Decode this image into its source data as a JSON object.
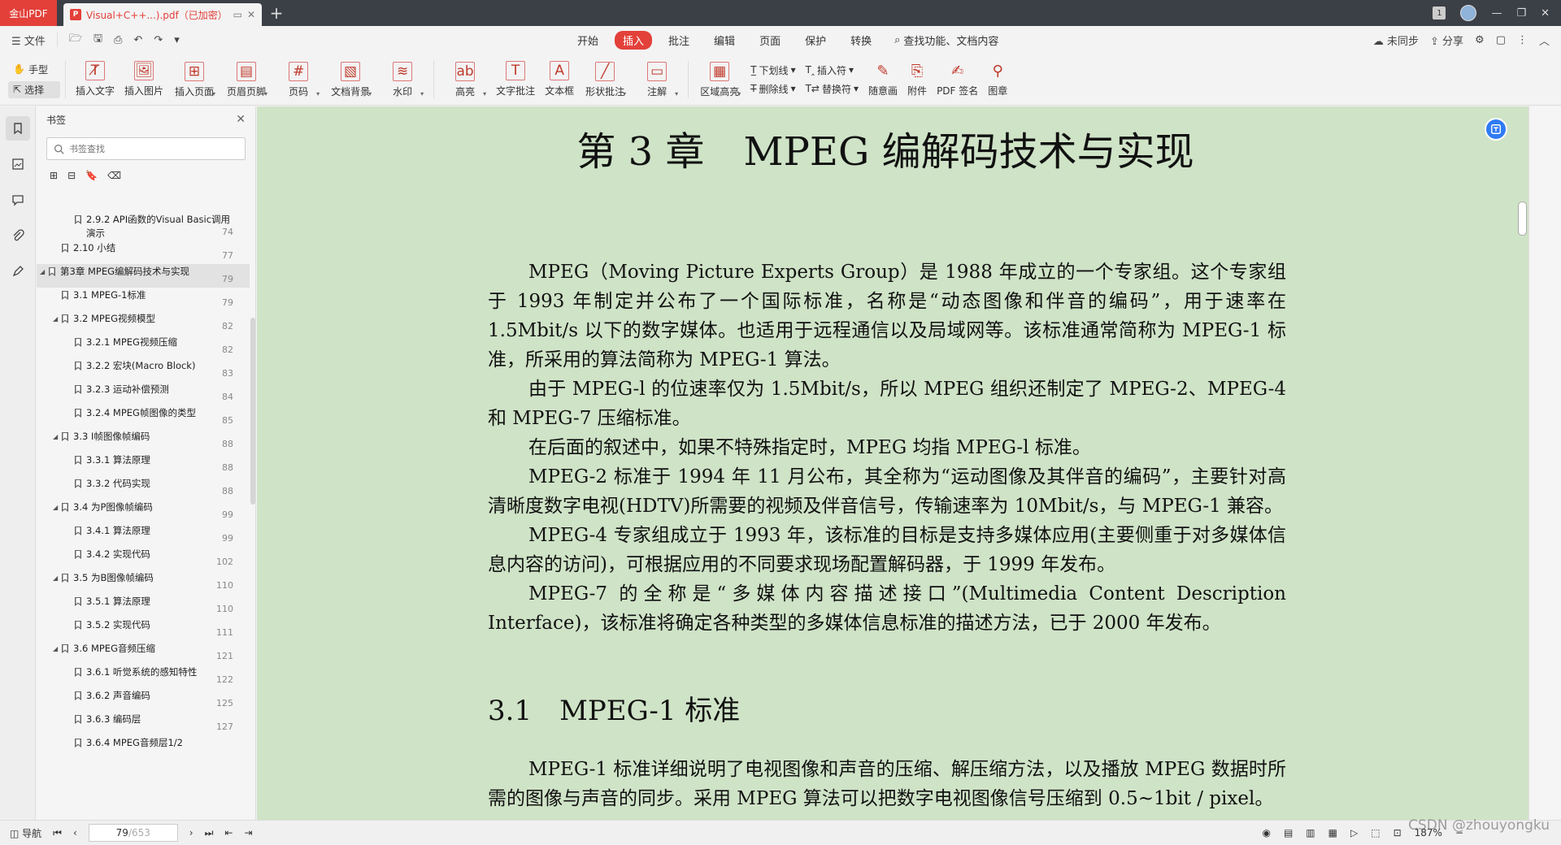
{
  "titlebar": {
    "app_name": "金山PDF",
    "tab_title": "Visual+C++...).pdf（已加密）",
    "tab_badge": "1"
  },
  "menubar": {
    "file_label": "文件",
    "tabs": [
      "开始",
      "插入",
      "批注",
      "编辑",
      "页面",
      "保护",
      "转换"
    ],
    "active_tab": "插入",
    "search_label": "查找功能、文档内容",
    "sync_label": "未同步",
    "share_label": "分享"
  },
  "ribbon": {
    "hand_label": "手型",
    "select_label": "选择",
    "buttons": [
      "插入文字",
      "插入图片",
      "插入页面",
      "页眉页脚",
      "页码",
      "文档背景",
      "水印",
      "高亮",
      "文字批注",
      "文本框",
      "形状批注",
      "注解",
      "区域高亮"
    ],
    "pair1": [
      "下划线",
      "删除线"
    ],
    "pair2": [
      "插入符",
      "替换符"
    ],
    "tail_buttons": [
      "随意画",
      "附件",
      "PDF 签名",
      "图章"
    ]
  },
  "panel": {
    "title": "书签",
    "search_placeholder": "书签查找",
    "items": [
      {
        "label": "2.9.2 API函数的Visual Basic调用演示",
        "page": "74",
        "level": 2,
        "toggle": ""
      },
      {
        "label": "2.10 小结",
        "page": "77",
        "level": 1,
        "toggle": ""
      },
      {
        "label": "第3章 MPEG编解码技术与实现",
        "page": "79",
        "level": 0,
        "toggle": "◢"
      },
      {
        "label": "3.1 MPEG-1标准",
        "page": "79",
        "level": 1,
        "toggle": ""
      },
      {
        "label": "3.2 MPEG视频模型",
        "page": "82",
        "level": 1,
        "toggle": "◢"
      },
      {
        "label": "3.2.1 MPEG视频压缩",
        "page": "82",
        "level": 2,
        "toggle": ""
      },
      {
        "label": "3.2.2 宏块(Macro Block)",
        "page": "83",
        "level": 2,
        "toggle": ""
      },
      {
        "label": "3.2.3 运动补偿预测",
        "page": "84",
        "level": 2,
        "toggle": ""
      },
      {
        "label": "3.2.4 MPEG帧图像的类型",
        "page": "85",
        "level": 2,
        "toggle": ""
      },
      {
        "label": "3.3 I帧图像帧编码",
        "page": "88",
        "level": 1,
        "toggle": "◢"
      },
      {
        "label": "3.3.1 算法原理",
        "page": "88",
        "level": 2,
        "toggle": ""
      },
      {
        "label": "3.3.2 代码实现",
        "page": "88",
        "level": 2,
        "toggle": ""
      },
      {
        "label": "3.4 为P图像帧编码",
        "page": "99",
        "level": 1,
        "toggle": "◢"
      },
      {
        "label": "3.4.1 算法原理",
        "page": "99",
        "level": 2,
        "toggle": ""
      },
      {
        "label": "3.4.2 实现代码",
        "page": "102",
        "level": 2,
        "toggle": ""
      },
      {
        "label": "3.5 为B图像帧编码",
        "page": "110",
        "level": 1,
        "toggle": "◢"
      },
      {
        "label": "3.5.1 算法原理",
        "page": "110",
        "level": 2,
        "toggle": ""
      },
      {
        "label": "3.5.2 实现代码",
        "page": "111",
        "level": 2,
        "toggle": ""
      },
      {
        "label": "3.6 MPEG音频压缩",
        "page": "121",
        "level": 1,
        "toggle": "◢"
      },
      {
        "label": "3.6.1 听觉系统的感知特性",
        "page": "122",
        "level": 2,
        "toggle": ""
      },
      {
        "label": "3.6.2 声音编码",
        "page": "125",
        "level": 2,
        "toggle": ""
      },
      {
        "label": "3.6.3 编码层",
        "page": "127",
        "level": 2,
        "toggle": ""
      },
      {
        "label": "3.6.4 MPEG音频层1/2",
        "page": "",
        "level": 2,
        "toggle": ""
      }
    ],
    "selected_index": 2
  },
  "document": {
    "chapter_title": "第 3 章　MPEG 编解码技术与实现",
    "paragraphs": [
      "MPEG（Moving Picture Experts Group）是 1988 年成立的一个专家组。这个专家组于 1993 年制定并公布了一个国际标准，名称是“动态图像和伴音的编码”，用于速率在 1.5Mbit/s 以下的数字媒体。也适用于远程通信以及局域网等。该标准通常简称为 MPEG-1 标准，所采用的算法简称为 MPEG-1 算法。",
      "由于 MPEG-l 的位速率仅为 1.5Mbit/s，所以 MPEG 组织还制定了 MPEG-2、MPEG-4 和 MPEG-7 压缩标准。",
      "在后面的叙述中，如果不特殊指定时，MPEG 均指 MPEG-l 标准。",
      "MPEG-2 标准于 1994 年 11 月公布，其全称为“运动图像及其伴音的编码”，主要针对高清晰度数字电视(HDTV)所需要的视频及伴音信号，传输速率为 10Mbit/s，与 MPEG-1 兼容。",
      "MPEG-4 专家组成立于 1993 年，该标准的目标是支持多媒体应用(主要侧重于对多媒体信息内容的访问)，可根据应用的不同要求现场配置解码器，于 1999 年发布。",
      "MPEG-7 的全称是“多媒体内容描述接口”(Multimedia Content Description Interface)，该标准将确定各种类型的多媒体信息标准的描述方法，已于 2000 年发布。"
    ],
    "section_title": "3.1　MPEG-1 标准",
    "section_paragraphs": [
      "MPEG-1 标准详细说明了电视图像和声音的压缩、解压缩方法，以及播放 MPEG 数据时所需的图像与声音的同步。采用 MPEG 算法可以把数字电视图像信号压缩到 0.5~1bit / pixel。"
    ]
  },
  "status": {
    "nav_label": "导航",
    "current_page": "79",
    "total_pages": "/653",
    "zoom": "187%"
  },
  "watermark": "CSDN @zhouyongku"
}
